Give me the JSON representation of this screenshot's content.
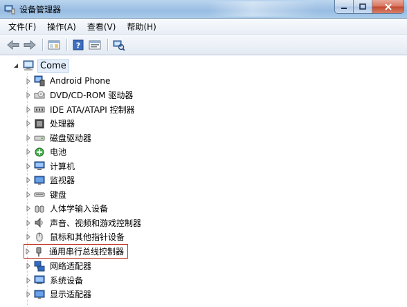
{
  "window": {
    "title": "设备管理器"
  },
  "menu": [
    {
      "label": "文件(F)"
    },
    {
      "label": "操作(A)"
    },
    {
      "label": "查看(V)"
    },
    {
      "label": "帮助(H)"
    }
  ],
  "toolbar": {
    "buttons": [
      "back-arrow-icon",
      "forward-arrow-icon",
      "show-hide-console-tree-icon",
      "help-icon",
      "properties-icon",
      "scan-hardware-icon"
    ]
  },
  "tree": {
    "root": {
      "label": "Come",
      "expanded": true
    },
    "nodes": [
      {
        "label": "Android Phone",
        "icon": "android-phone-icon"
      },
      {
        "label": "DVD/CD-ROM 驱动器",
        "icon": "optical-drive-icon"
      },
      {
        "label": "IDE ATA/ATAPI 控制器",
        "icon": "ide-controller-icon"
      },
      {
        "label": "处理器",
        "icon": "processor-icon"
      },
      {
        "label": "磁盘驱动器",
        "icon": "disk-drive-icon"
      },
      {
        "label": "电池",
        "icon": "battery-icon"
      },
      {
        "label": "计算机",
        "icon": "computer-icon"
      },
      {
        "label": "监视器",
        "icon": "monitor-icon"
      },
      {
        "label": "键盘",
        "icon": "keyboard-icon"
      },
      {
        "label": "人体学输入设备",
        "icon": "hid-icon"
      },
      {
        "label": "声音、视频和游戏控制器",
        "icon": "sound-icon"
      },
      {
        "label": "鼠标和其他指针设备",
        "icon": "mouse-icon"
      },
      {
        "label": "通用串行总线控制器",
        "icon": "usb-icon",
        "highlighted": true
      },
      {
        "label": "网络适配器",
        "icon": "network-adapter-icon"
      },
      {
        "label": "系统设备",
        "icon": "system-devices-icon"
      },
      {
        "label": "显示适配器",
        "icon": "display-adapter-icon"
      }
    ]
  },
  "colors": {
    "highlight_border": "#c0392b",
    "titlebar": "#a4c4e6"
  }
}
